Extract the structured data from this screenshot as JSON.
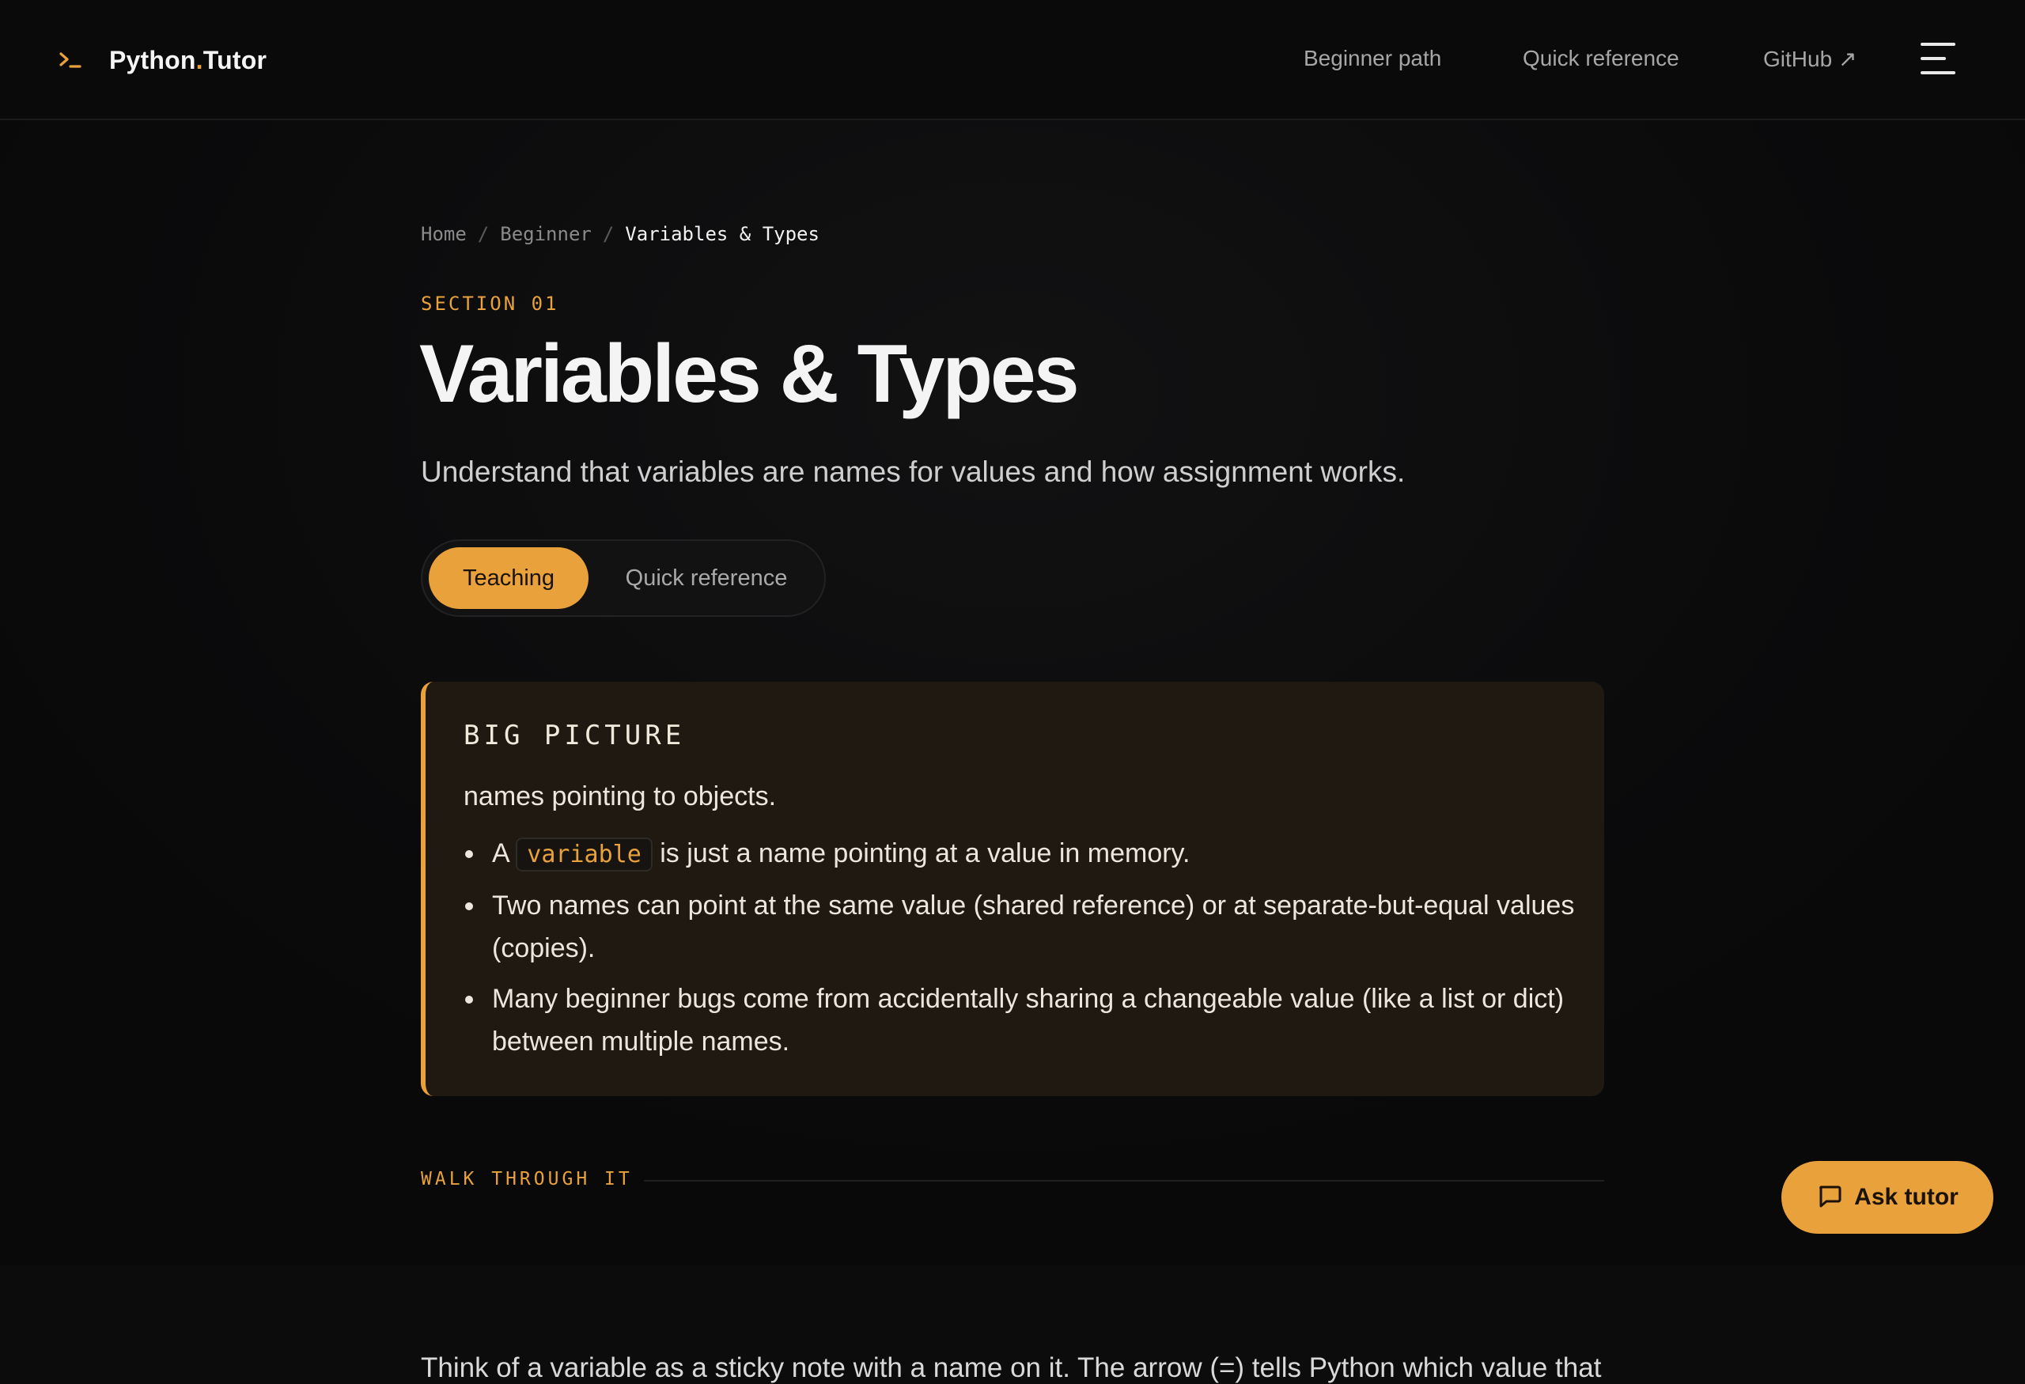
{
  "brand": {
    "name_main": "Python",
    "name_dot": ".",
    "name_tail": "Tutor"
  },
  "nav": {
    "items": [
      {
        "label": "Beginner path"
      },
      {
        "label": "Quick reference"
      },
      {
        "label": "GitHub ↗"
      }
    ]
  },
  "breadcrumb": {
    "items": [
      "Home",
      "Beginner"
    ],
    "current": "Variables & Types",
    "separator": "/"
  },
  "page": {
    "eyebrow": "SECTION 01",
    "title": "Variables & Types",
    "subtitle": "Understand that variables are names for values and how assignment works."
  },
  "mode_toggle": {
    "options": [
      "Teaching",
      "Quick reference"
    ],
    "selected": "Teaching"
  },
  "callout": {
    "heading": "BIG PICTURE",
    "lead": "names pointing to objects.",
    "bullet1": {
      "pre": "A",
      "code": "variable",
      "post": "is just a name pointing at a value in memory."
    },
    "bullet2": "Two names can point at the same value (shared reference) or at separate-but-equal values (copies).",
    "bullet3": "Many beginner bugs come from accidentally sharing a changeable value (like a list or dict) between multiple names."
  },
  "walkthrough": {
    "label": "WALK THROUGH IT",
    "text": "Think of a variable as a sticky note with a name on it. The arrow (=) tells Python which value that"
  },
  "ask_tutor": {
    "label": "Ask tutor"
  },
  "theme": {
    "accent": "#e9a23b",
    "background": "#0c0c0d",
    "callout_bg": "#201911"
  }
}
